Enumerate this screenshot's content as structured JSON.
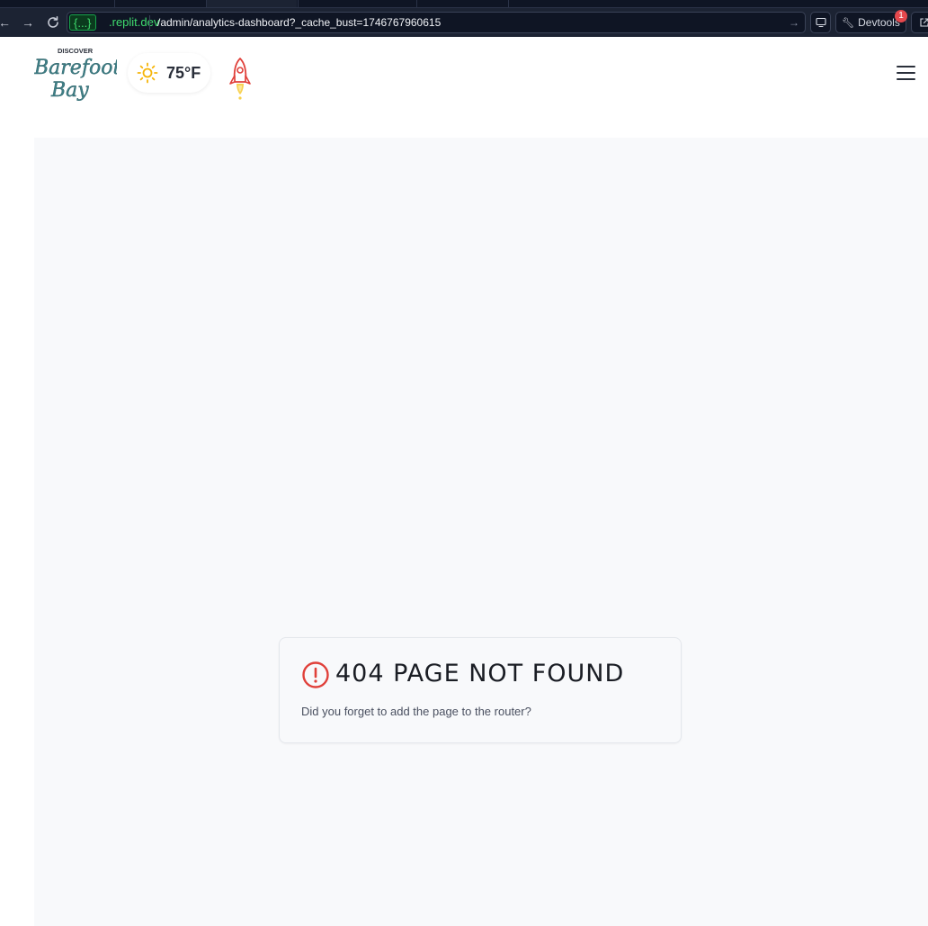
{
  "browser": {
    "nav": {
      "back_icon": "←",
      "forward_icon": "→",
      "reload_icon": "⟳"
    },
    "address": {
      "host_badge": "{...}",
      "host_domain": ".replit.dev",
      "path": "/admin/analytics-dashboard?_cache_bust=1746767960615",
      "go_icon": "→"
    },
    "devtools": {
      "label": "Devtools",
      "badge_count": "1"
    }
  },
  "header": {
    "logo": {
      "top_text": "DISCOVER",
      "line1": "Barefoot",
      "line2": "Bay"
    },
    "weather": {
      "icon": "sun-icon",
      "temperature": "75°F",
      "icon_color": "#f5b50a"
    },
    "rocket_icon": "rocket-icon",
    "menu_icon": "hamburger-menu-icon"
  },
  "not_found": {
    "title": "404 PAGE NOT FOUND",
    "message": "Did you forget to add the page to the router?",
    "icon": "alert-circle-icon",
    "icon_color": "#e0403a"
  },
  "colors": {
    "chrome_bg": "#1c2333",
    "host_green": "#3fdc6e",
    "main_bg": "#f8f9fb",
    "logo_teal": "#3e7f86"
  }
}
